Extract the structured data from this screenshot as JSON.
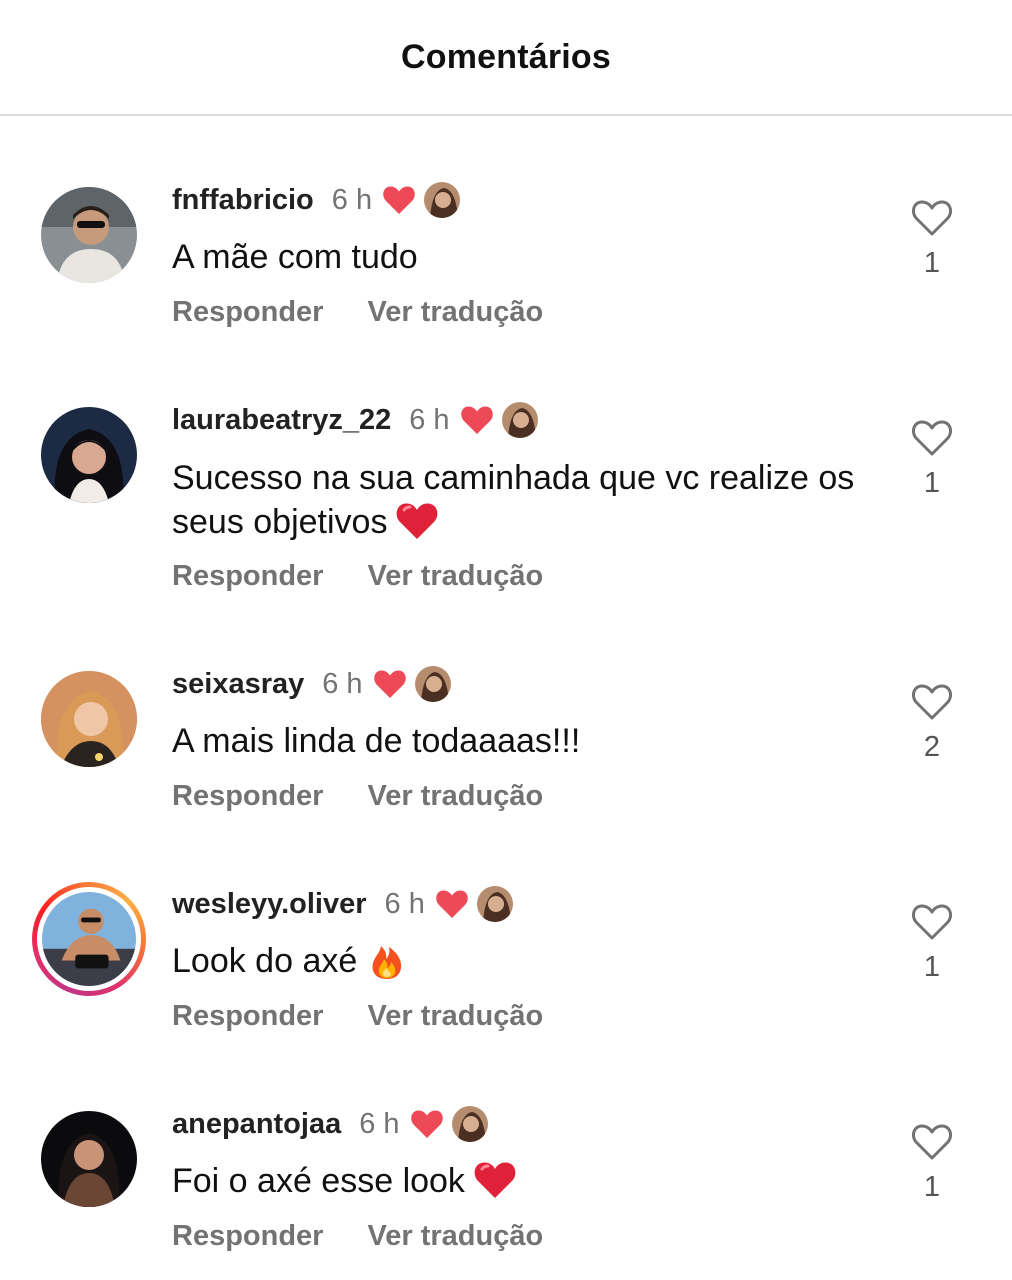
{
  "header": {
    "title": "Comentários"
  },
  "colors": {
    "heart_red": "#ed4956",
    "secondary_text": "#737373"
  },
  "comments": [
    {
      "username": "fnffabricio",
      "time": "6 h",
      "text": "A mãe com tudo",
      "emoji": "",
      "reply_label": "Responder",
      "translate_label": "Ver tradução",
      "likes": "1",
      "liked_by_author": true,
      "story_ring": false
    },
    {
      "username": "laurabeatryz_22",
      "time": "6 h",
      "text": "Sucesso na sua caminhada que vc realize os seus objetivos",
      "emoji": "red-heart",
      "reply_label": "Responder",
      "translate_label": "Ver tradução",
      "likes": "1",
      "liked_by_author": true,
      "story_ring": false
    },
    {
      "username": "seixasray",
      "time": "6 h",
      "text": "A mais linda de todaaaas!!!",
      "emoji": "",
      "reply_label": "Responder",
      "translate_label": "Ver tradução",
      "likes": "2",
      "liked_by_author": true,
      "story_ring": false
    },
    {
      "username": "wesleyy.oliver",
      "time": "6 h",
      "text": "Look do axé",
      "emoji": "fire",
      "reply_label": "Responder",
      "translate_label": "Ver tradução",
      "likes": "1",
      "liked_by_author": true,
      "story_ring": true
    },
    {
      "username": "anepantojaa",
      "time": "6 h",
      "text": "Foi o axé esse look",
      "emoji": "red-heart",
      "reply_label": "Responder",
      "translate_label": "Ver tradução",
      "likes": "1",
      "liked_by_author": true,
      "story_ring": false
    }
  ]
}
